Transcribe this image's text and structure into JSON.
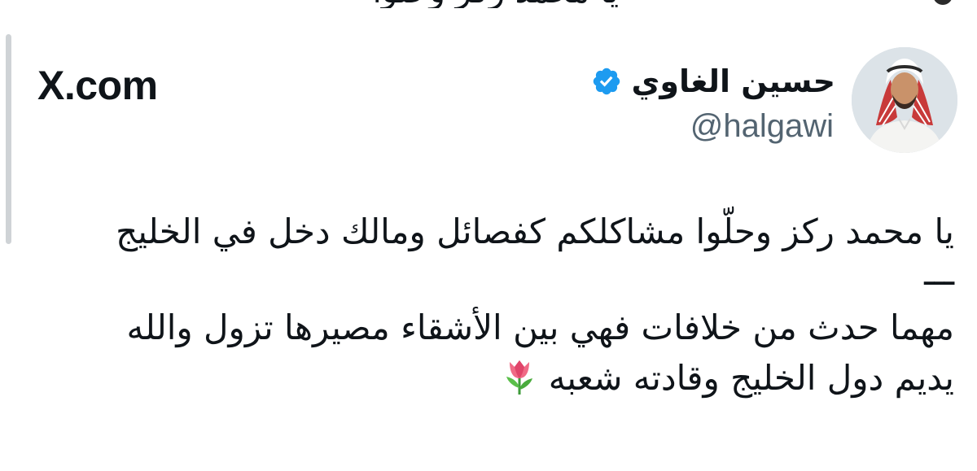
{
  "source_label": "X.com",
  "author": {
    "display_name": "حسين الغاوي",
    "handle": "@halgawi",
    "verified_badge_icon": "verified-badge-icon",
    "badge_color": "#1d9bf0",
    "avatar_icon": "profile-avatar-icon"
  },
  "tweet": {
    "lines": [
      "يا محمد ركز وحلّوا مشاكلكم كفصائل ومالك دخل في الخليج",
      "ـــ",
      "مهما حدث من خلافات فهي بين الأشقاء مصيرها تزول والله",
      "يديم دول الخليج وقادته شعبه"
    ],
    "emoji_icon": "tulip-emoji-icon"
  },
  "colors": {
    "text": "#0f1419",
    "secondary_text": "#536471",
    "quote_bar": "#cfd3d6"
  }
}
